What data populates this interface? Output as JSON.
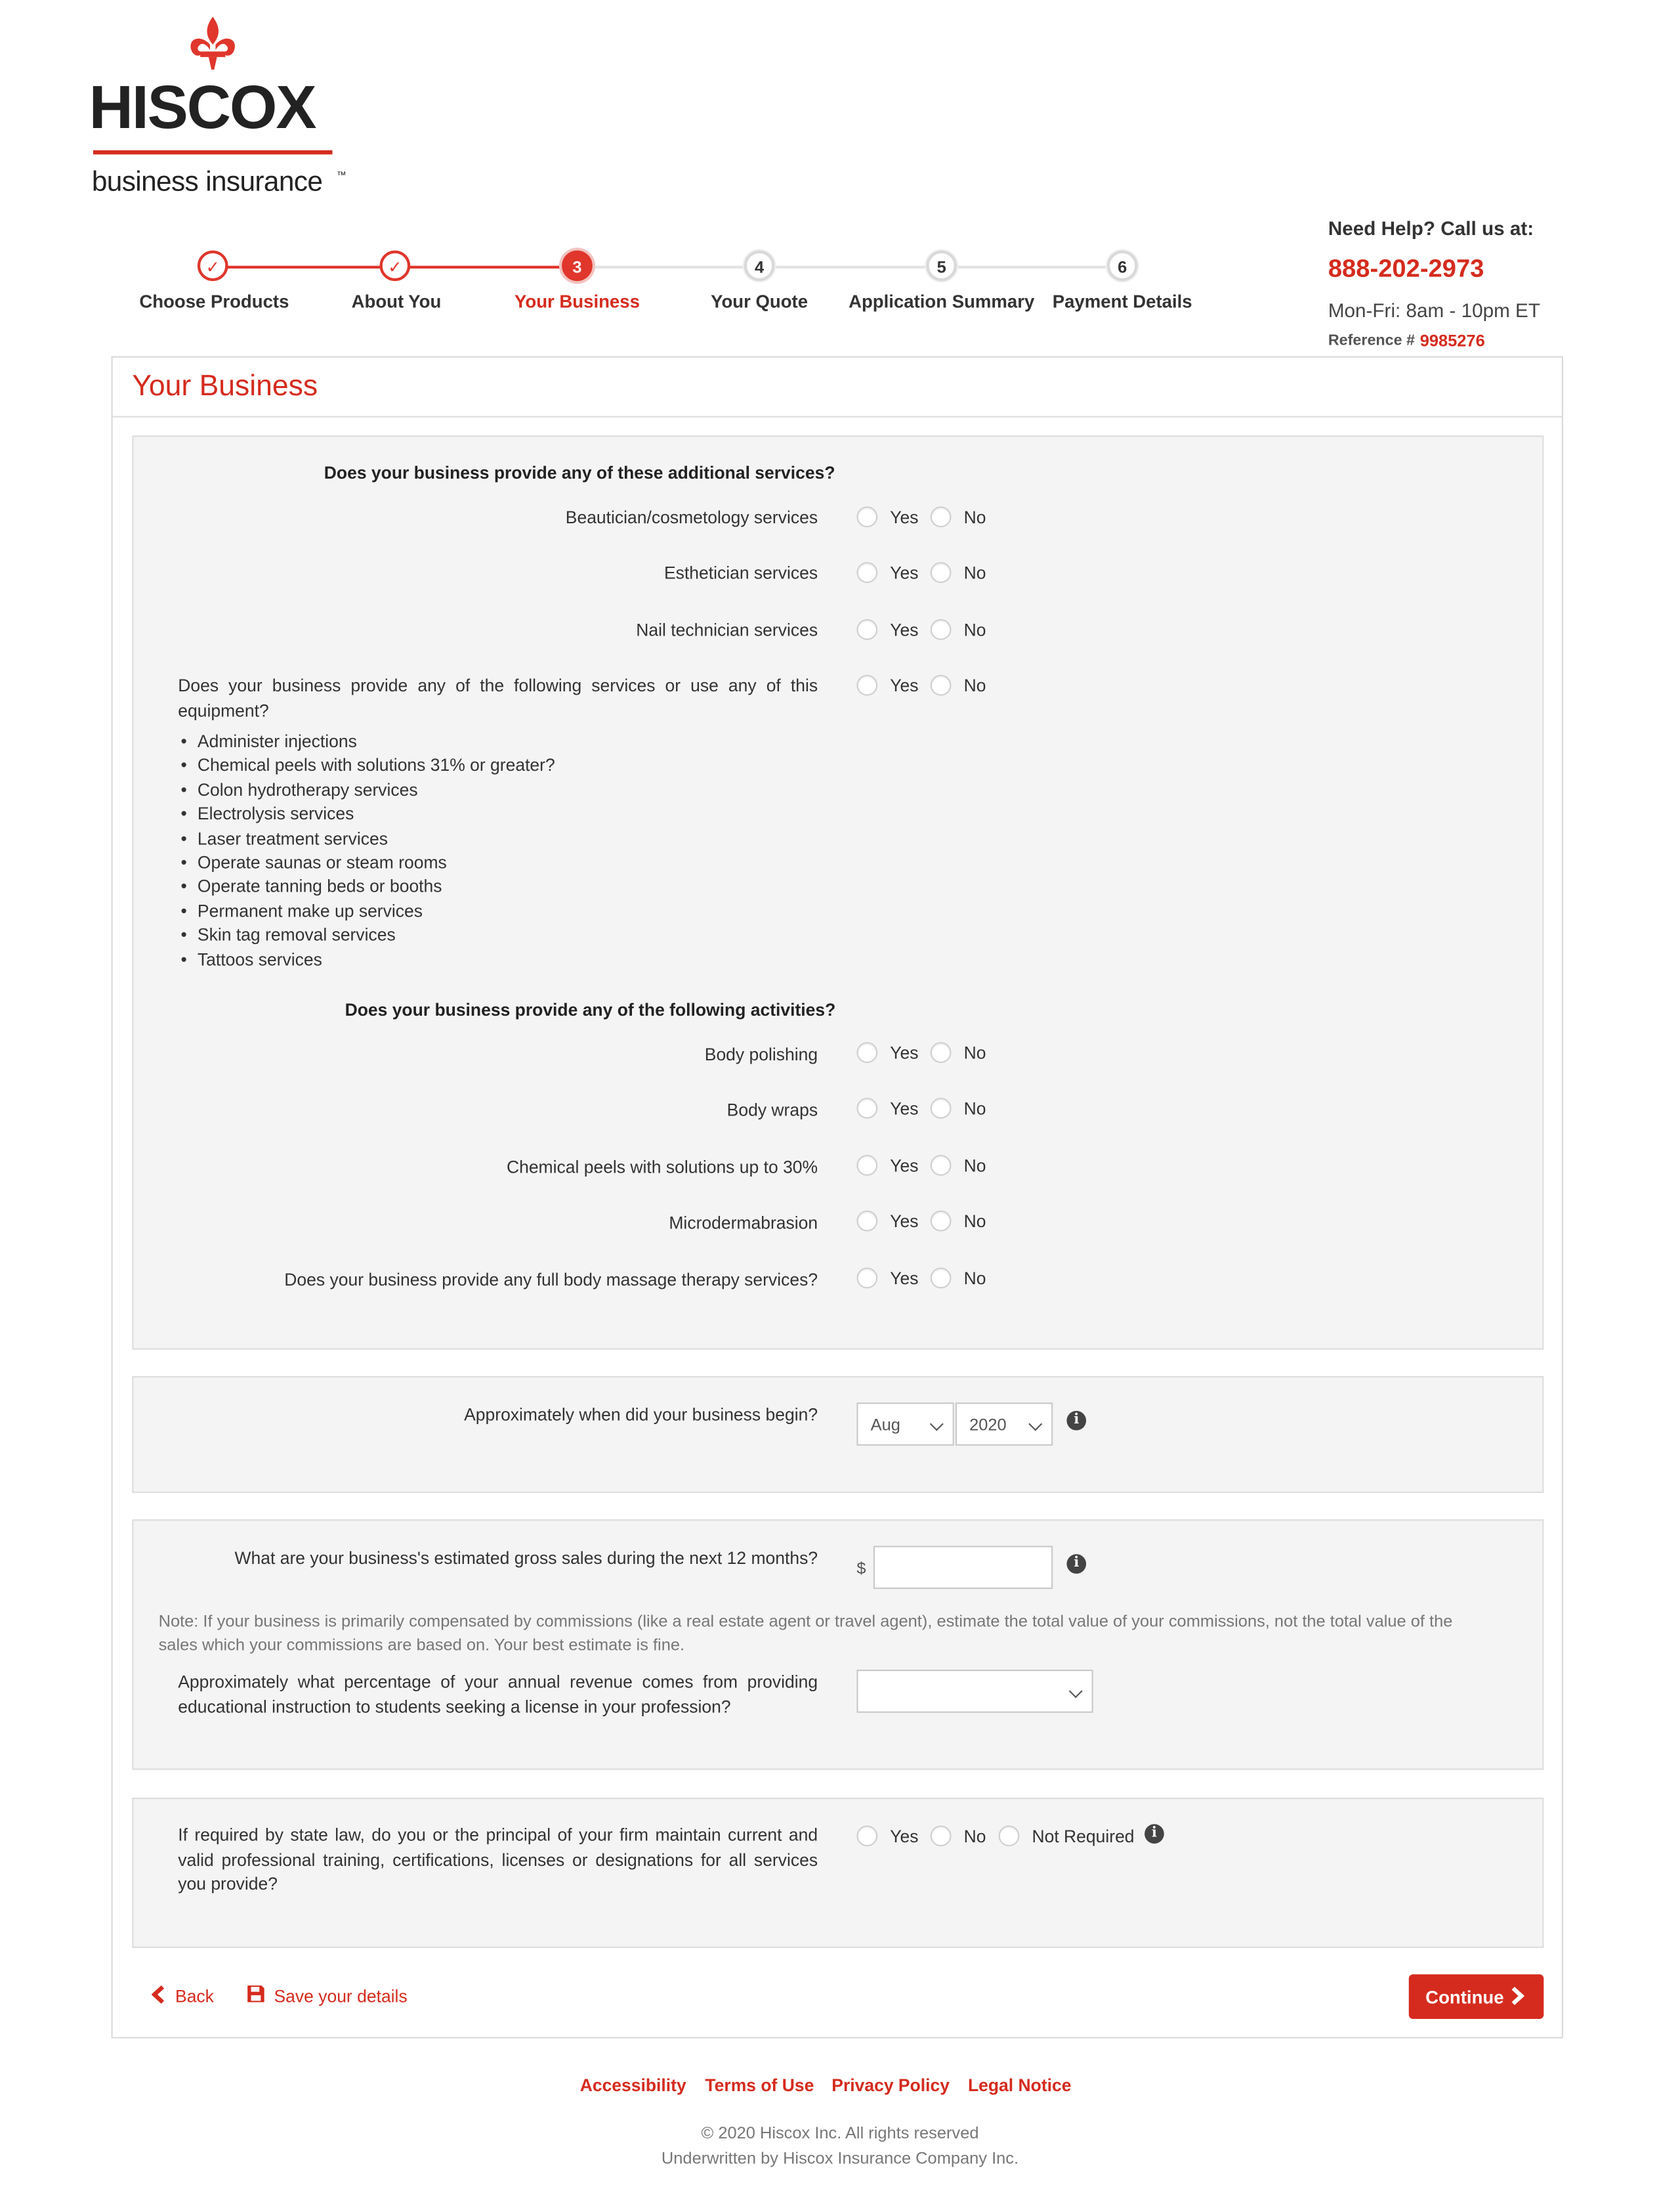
{
  "header": {
    "logo_word": "HISCOX",
    "logo_sub": "business insurance",
    "logo_tm": "™"
  },
  "steps": [
    {
      "num": "✓",
      "label": "Choose Products",
      "state": "done"
    },
    {
      "num": "✓",
      "label": "About You",
      "state": "done"
    },
    {
      "num": "3",
      "label": "Your Business",
      "state": "current"
    },
    {
      "num": "4",
      "label": "Your Quote",
      "state": "todo"
    },
    {
      "num": "5",
      "label": "Application Summary",
      "state": "todo"
    },
    {
      "num": "6",
      "label": "Payment Details",
      "state": "todo"
    }
  ],
  "help": {
    "title": "Need Help? Call us at:",
    "phone": "888-202-2973",
    "hours": "Mon-Fri: 8am - 10pm ET",
    "ref_label": "Reference #",
    "ref_number": "9985276"
  },
  "page_title": "Your Business",
  "yes_label": "Yes",
  "no_label": "No",
  "not_required_label": "Not Required",
  "services": {
    "heading": "Does your business provide any of these additional services?",
    "items": [
      "Beautician/cosmetology services",
      "Esthetician services",
      "Nail technician services"
    ],
    "equipment_question": "Does your business provide any of the following services or use any of this equipment?",
    "equipment_list": [
      "Administer injections",
      "Chemical peels with solutions 31% or greater?",
      "Colon hydrotherapy services",
      "Electrolysis services",
      "Laser treatment services",
      "Operate saunas or steam rooms",
      "Operate tanning beds or booths",
      "Permanent make up services",
      "Skin tag removal services",
      "Tattoos services"
    ]
  },
  "activities": {
    "heading": "Does your business provide any of the following activities?",
    "items": [
      "Body polishing",
      "Body wraps",
      "Chemical peels with solutions up to 30%",
      "Microdermabrasion",
      "Does your business provide any full body massage therapy services?"
    ]
  },
  "business_start": {
    "question": "Approximately when did your business begin?",
    "month": "Aug",
    "year": "2020"
  },
  "gross_sales": {
    "question": "What are your business's estimated gross sales during the next 12 months?",
    "currency": "$",
    "value": "",
    "note": "Note: If your business is primarily compensated by commissions (like a real estate agent or travel agent), estimate the total value of your commissions, not the total value of the sales which your commissions are based on. Your best estimate is fine."
  },
  "education_revenue": {
    "question": "Approximately what percentage of your annual revenue comes from providing educational instruction to students seeking a license in your profession?",
    "value": ""
  },
  "licensing": {
    "question": "If required by state law, do you or the principal of your firm maintain current and valid professional training, certifications, licenses or designations for all services you provide?"
  },
  "actions": {
    "back": "Back",
    "save": "Save your details",
    "continue": "Continue"
  },
  "footer": {
    "links": [
      "Accessibility",
      "Terms of Use",
      "Privacy Policy",
      "Legal Notice"
    ],
    "copyright": "© 2020 Hiscox Inc. All rights reserved",
    "underwritten": "Underwritten by Hiscox Insurance Company Inc."
  },
  "colors": {
    "brand_red": "#d52b1e",
    "panel_bg": "#f4f4f4"
  }
}
